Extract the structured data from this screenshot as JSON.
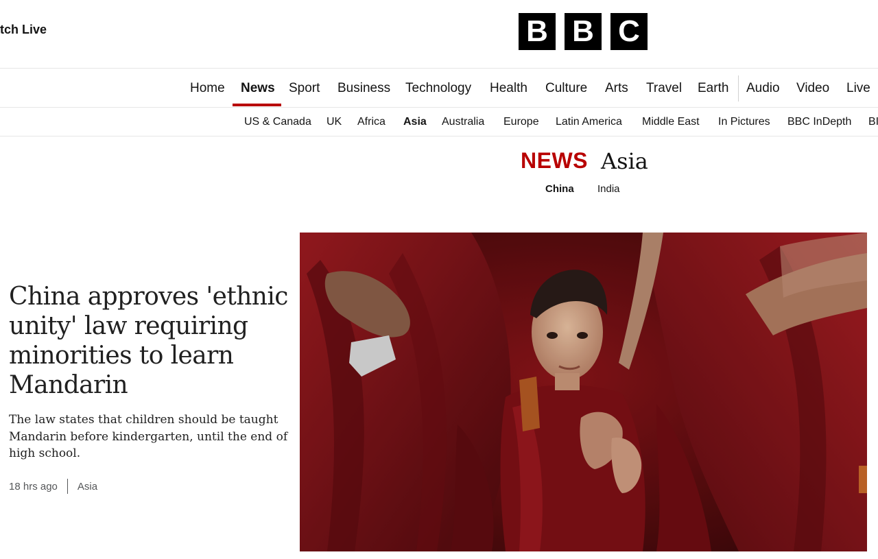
{
  "topbar": {
    "watch_live": "atch Live",
    "logo_letters": [
      "B",
      "B",
      "C"
    ]
  },
  "nav": {
    "items": [
      {
        "label": "Home",
        "active": false
      },
      {
        "label": "News",
        "active": true
      },
      {
        "label": "Sport",
        "active": false
      },
      {
        "label": "Business",
        "active": false
      },
      {
        "label": "Technology",
        "active": false
      },
      {
        "label": "Health",
        "active": false
      },
      {
        "label": "Culture",
        "active": false
      },
      {
        "label": "Arts",
        "active": false
      },
      {
        "label": "Travel",
        "active": false
      },
      {
        "label": "Earth",
        "active": false
      },
      {
        "label": "Audio",
        "active": false
      },
      {
        "label": "Video",
        "active": false
      },
      {
        "label": "Live",
        "active": false
      }
    ]
  },
  "subnav": {
    "items": [
      {
        "label": "US & Canada",
        "active": false
      },
      {
        "label": "UK",
        "active": false
      },
      {
        "label": "Africa",
        "active": false
      },
      {
        "label": "Asia",
        "active": true
      },
      {
        "label": "Australia",
        "active": false
      },
      {
        "label": "Europe",
        "active": false
      },
      {
        "label": "Latin America",
        "active": false
      },
      {
        "label": "Middle East",
        "active": false
      },
      {
        "label": "In Pictures",
        "active": false
      },
      {
        "label": "BBC InDepth",
        "active": false
      },
      {
        "label": "BI",
        "active": false
      }
    ]
  },
  "section": {
    "brand": "NEWS",
    "name": "Asia",
    "sub_links": [
      {
        "label": "China",
        "active": true
      },
      {
        "label": "India",
        "active": false
      }
    ]
  },
  "article": {
    "headline": "China approves 'ethnic unity' law requiring minorities to learn Mandarin",
    "summary": "The law states that children should be taught Mandarin before kindergarten, until the end of high school.",
    "time": "18 hrs ago",
    "tag": "Asia"
  },
  "colors": {
    "brand_red": "#b80000",
    "robe_red": "#7a0f14",
    "text": "#141414"
  },
  "icons": {
    "logo": "bbc-logo"
  }
}
